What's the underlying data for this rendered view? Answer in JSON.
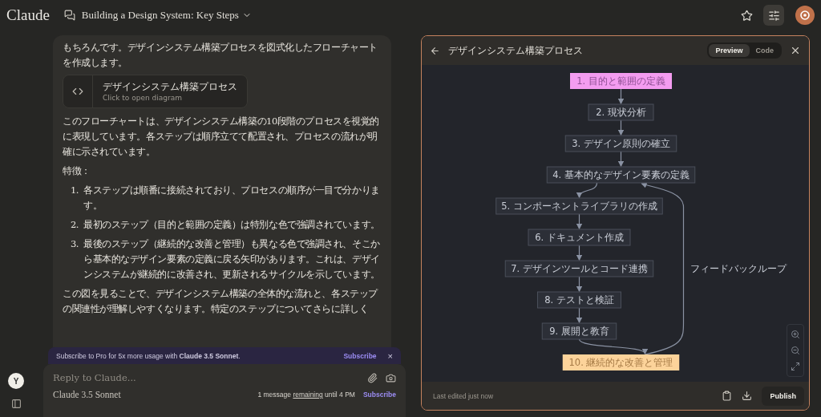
{
  "header": {
    "logo": "Claude",
    "chat_title": "Building a Design System: Key Steps",
    "settings_active": true
  },
  "message": {
    "intro": "もちろんです。デザインシステム構築プロセスを図式化したフローチャートを作成します。",
    "artifact": {
      "title": "デザインシステム構築プロセス",
      "subtitle": "Click to open diagram"
    },
    "paragraph": "このフローチャートは、デザインシステム構築の10段階のプロセスを視覚的に表現しています。各ステップは順序立てて配置され、プロセスの流れが明確に示されています。",
    "heading": "特徴：",
    "features": [
      {
        "number": "1.",
        "text": "各ステップは順番に接続されており、プロセスの順序が一目で分かります。"
      },
      {
        "number": "2.",
        "text": "最初のステップ（目的と範囲の定義）は特別な色で強調されています。"
      },
      {
        "number": "3.",
        "text": "最後のステップ（継続的な改善と管理）も異なる色で強調され、そこから基本的なデザイン要素の定義に戻る矢印があります。これは、デザインシステムが継続的に改善され、更新されるサイクルを示しています。"
      }
    ],
    "closing": "この図を見ることで、デザインシステム構築の全体的な流れと、各ステップの関連性が理解しやすくなります。特定のステップについてさらに詳しく"
  },
  "banner": {
    "text": "Subscribe to Pro for 5x more usage with **Claude 3.5 Sonnet**.",
    "action": "Subscribe",
    "close": "×"
  },
  "composer": {
    "placeholder": "Reply to Claude...",
    "model": "Claude 3.5 Sonnet",
    "usage_before": "1 message",
    "usage_link": "remaining",
    "usage_after": "until 4 PM",
    "subscribe": "Subscribe"
  },
  "sidebar": {
    "avatar": "Y"
  },
  "artifact_panel": {
    "title": "デザインシステム構築プロセス",
    "tabs": [
      {
        "label": "Preview",
        "selected": true
      },
      {
        "label": "Code",
        "selected": false
      }
    ],
    "flowchart": {
      "nodes": [
        {
          "label": "1. 目的と範囲の定義",
          "kind": "start"
        },
        {
          "label": "2. 現状分析",
          "kind": "step"
        },
        {
          "label": "3. デザイン原則の確立",
          "kind": "step"
        },
        {
          "label": "4. 基本的なデザイン要素の定義",
          "kind": "step",
          "loop_target": true
        },
        {
          "label": "5. コンポーネントライブラリの作成",
          "kind": "step"
        },
        {
          "label": "6. ドキュメント作成",
          "kind": "step"
        },
        {
          "label": "7. デザインツールとコード連携",
          "kind": "step"
        },
        {
          "label": "8. テストと検証",
          "kind": "step"
        },
        {
          "label": "9. 展開と教育",
          "kind": "step"
        },
        {
          "label": "10. 継続的な改善と管理",
          "kind": "end"
        }
      ],
      "feedback_label": "フィードバックループ"
    },
    "footer": {
      "status": "Last edited just now",
      "publish": "Publish"
    }
  }
}
